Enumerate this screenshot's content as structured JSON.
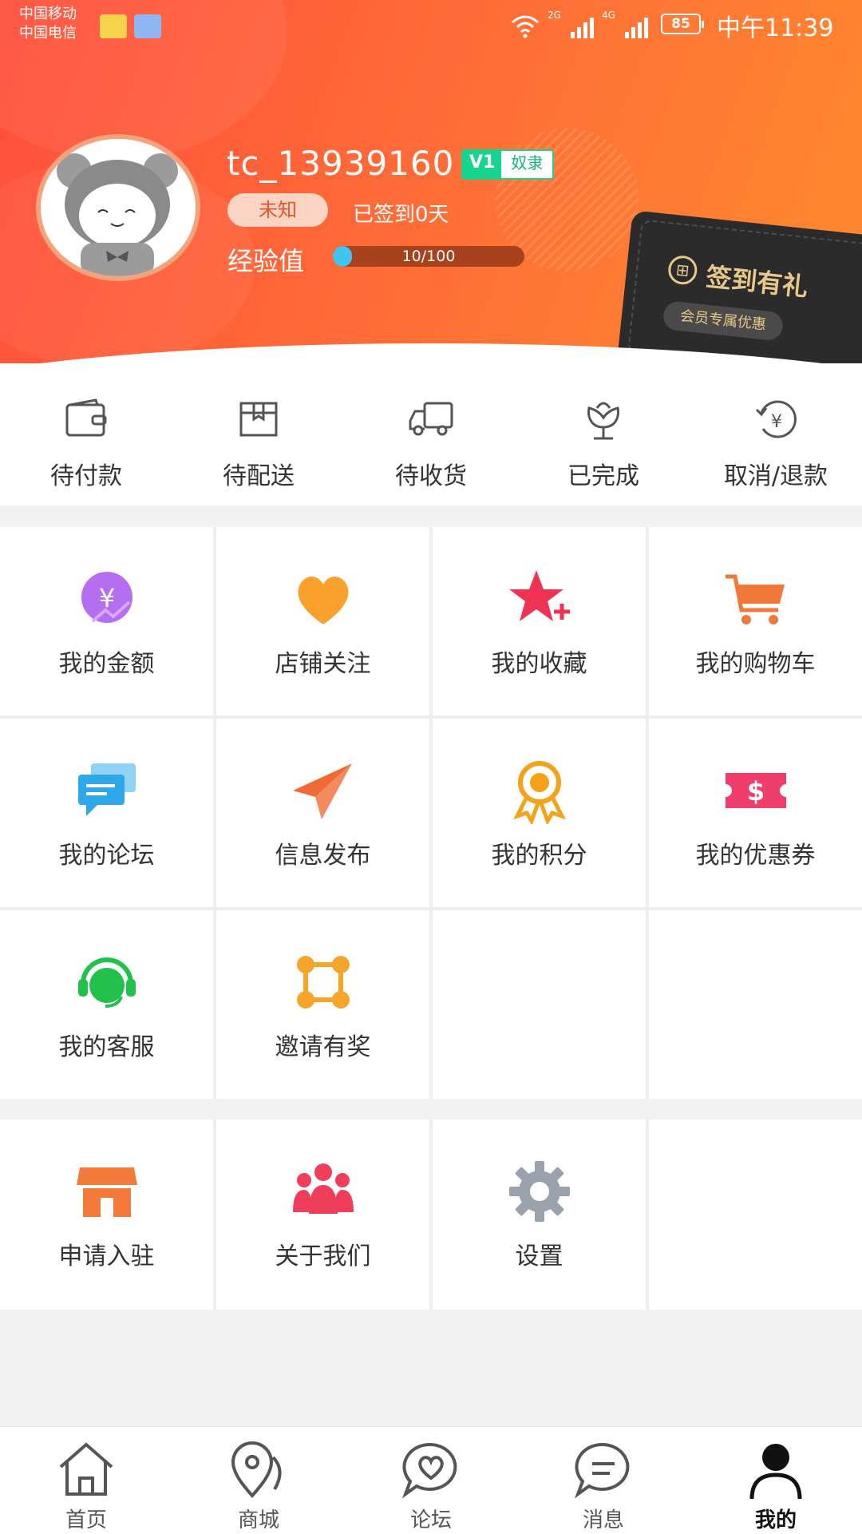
{
  "status_bar": {
    "carrier1": "中国移动",
    "carrier2": "中国电信",
    "net1": "2G",
    "net2": "4G",
    "battery": "85",
    "time": "中午11:39"
  },
  "profile": {
    "username": "tc_13939160",
    "vip_level": "V1",
    "vip_title": "奴隶",
    "gender": "未知",
    "signed_text": "已签到0天",
    "exp_label": "经验值",
    "exp_text": "10/100",
    "exp_progress": 0.1
  },
  "sign_card": {
    "icon": "gift-icon",
    "title": "签到有礼",
    "subtitle": "会员专属优惠"
  },
  "orders": [
    {
      "label": "待付款",
      "icon": "wallet-icon"
    },
    {
      "label": "待配送",
      "icon": "box-icon"
    },
    {
      "label": "待收货",
      "icon": "truck-icon"
    },
    {
      "label": "已完成",
      "icon": "flower-icon"
    },
    {
      "label": "取消/退款",
      "icon": "refund-icon"
    }
  ],
  "grid_main": [
    {
      "label": "我的金额",
      "icon": "money-icon",
      "color": "#b56ef0"
    },
    {
      "label": "店铺关注",
      "icon": "heart-icon",
      "color": "#f9a12a"
    },
    {
      "label": "我的收藏",
      "icon": "star-plus-icon",
      "color": "#ef3355"
    },
    {
      "label": "我的购物车",
      "icon": "cart-icon",
      "color": "#f0793a"
    },
    {
      "label": "我的论坛",
      "icon": "chat-icon",
      "color": "#2fa8e9"
    },
    {
      "label": "信息发布",
      "icon": "paper-plane-icon",
      "color": "#f06a36"
    },
    {
      "label": "我的积分",
      "icon": "badge-icon",
      "color": "#f4a21c"
    },
    {
      "label": "我的优惠券",
      "icon": "coupon-icon",
      "color": "#ef3d6c"
    },
    {
      "label": "我的客服",
      "icon": "headset-icon",
      "color": "#22c14b"
    },
    {
      "label": "邀请有奖",
      "icon": "network-icon",
      "color": "#f6a52a"
    },
    {
      "label": "",
      "icon": ""
    },
    {
      "label": "",
      "icon": ""
    }
  ],
  "grid_secondary": [
    {
      "label": "申请入驻",
      "icon": "store-icon",
      "color": "#f27b39"
    },
    {
      "label": "关于我们",
      "icon": "people-icon",
      "color": "#ef3d5a"
    },
    {
      "label": "设置",
      "icon": "settings-icon",
      "color": "#9aa2ad"
    },
    {
      "label": "",
      "icon": ""
    }
  ],
  "tabbar": [
    {
      "label": "首页",
      "icon": "home-icon",
      "active": false
    },
    {
      "label": "商城",
      "icon": "location-icon",
      "active": false
    },
    {
      "label": "论坛",
      "icon": "forum-heart-icon",
      "active": false
    },
    {
      "label": "消息",
      "icon": "message-icon",
      "active": false
    },
    {
      "label": "我的",
      "icon": "user-icon",
      "active": true
    }
  ]
}
